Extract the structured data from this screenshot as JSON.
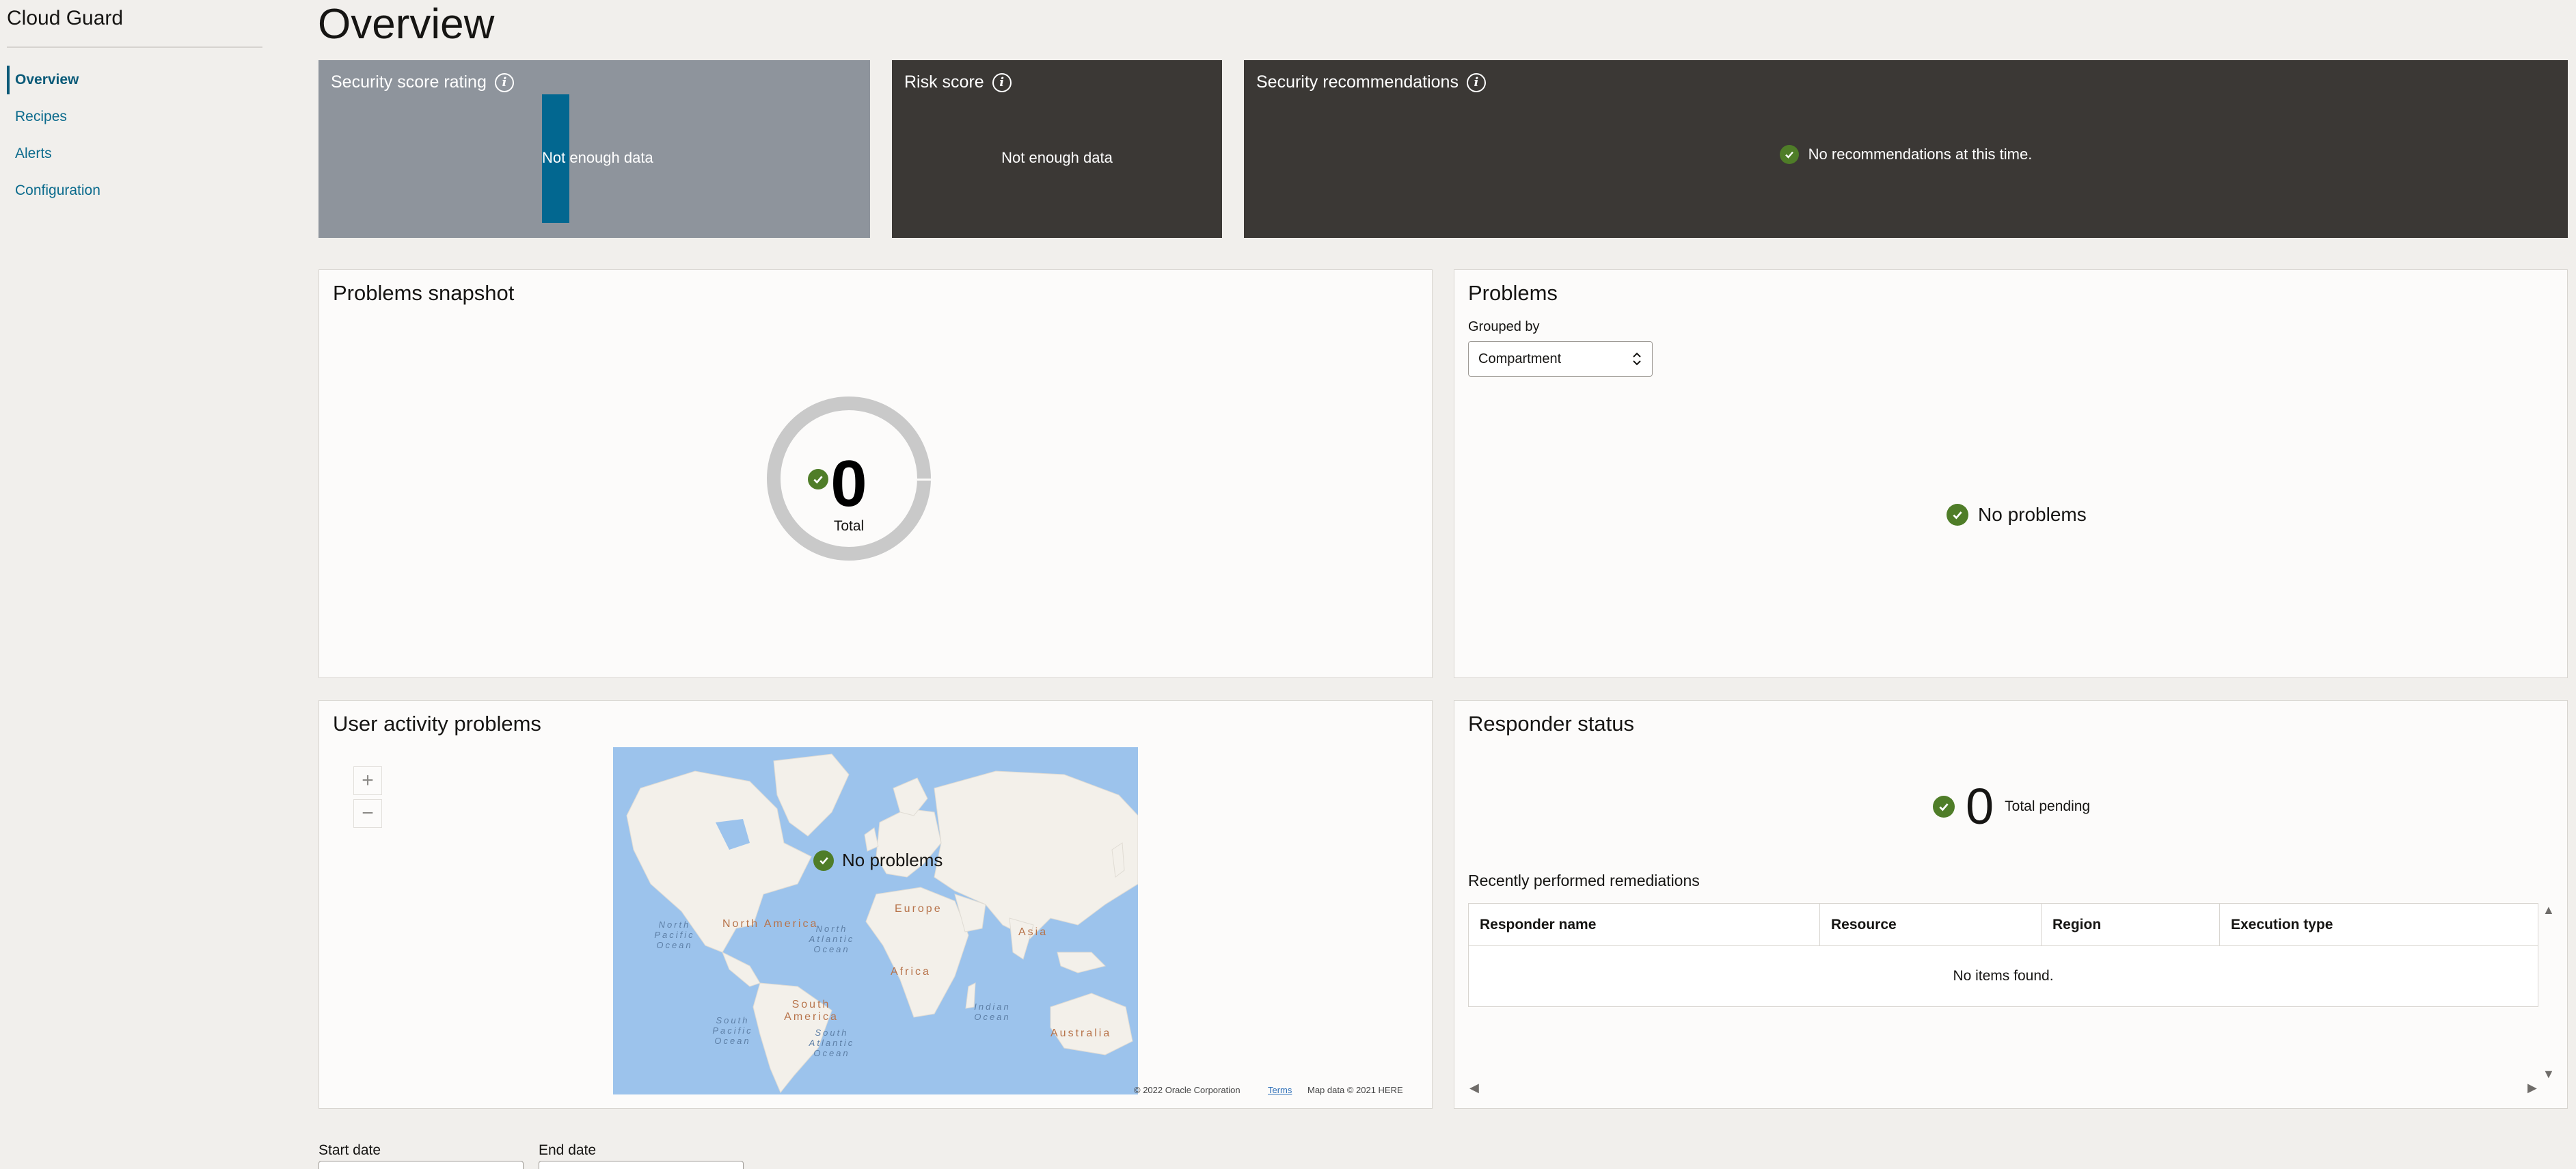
{
  "sidebar": {
    "title": "Cloud Guard",
    "items": [
      {
        "label": "Overview"
      },
      {
        "label": "Recipes"
      },
      {
        "label": "Alerts"
      },
      {
        "label": "Configuration"
      }
    ]
  },
  "page": {
    "title": "Overview"
  },
  "tiles": {
    "security_score": {
      "title": "Security score rating",
      "message": "Not enough data"
    },
    "risk_score": {
      "title": "Risk score",
      "message": "Not enough data"
    },
    "recommendations": {
      "title": "Security recommendations",
      "message": "No recommendations at this time."
    }
  },
  "problems_snapshot": {
    "title": "Problems snapshot",
    "total_value": "0",
    "total_label": "Total"
  },
  "problems": {
    "title": "Problems",
    "grouped_by_label": "Grouped by",
    "grouped_by_value": "Compartment",
    "empty_message": "No problems"
  },
  "user_activity": {
    "title": "User activity problems",
    "zoom_in": "+",
    "zoom_out": "−",
    "empty_message": "No problems",
    "continents": [
      "North America",
      "Europe",
      "Asia",
      "Africa",
      "South America",
      "Australia"
    ],
    "oceans": [
      "North Pacific Ocean",
      "North Atlantic Ocean",
      "Indian Ocean",
      "South Pacific Ocean",
      "South Atlantic Ocean"
    ],
    "attribution": {
      "copyright": "© 2022 Oracle Corporation",
      "terms": "Terms",
      "map_data": "Map data © 2021 HERE"
    }
  },
  "responder_status": {
    "title": "Responder status",
    "pending_value": "0",
    "pending_label": "Total pending",
    "recent_title": "Recently performed remediations",
    "columns": [
      "Responder name",
      "Resource",
      "Region",
      "Execution type"
    ],
    "empty_message": "No items found."
  },
  "dates": {
    "start_label": "Start date",
    "end_label": "End date"
  },
  "colors": {
    "accent": "#0a6a8c",
    "success": "#4f7d28",
    "tile_dark": "#3b3835",
    "tile_gray": "#8e949c",
    "score_bar": "#026790"
  }
}
